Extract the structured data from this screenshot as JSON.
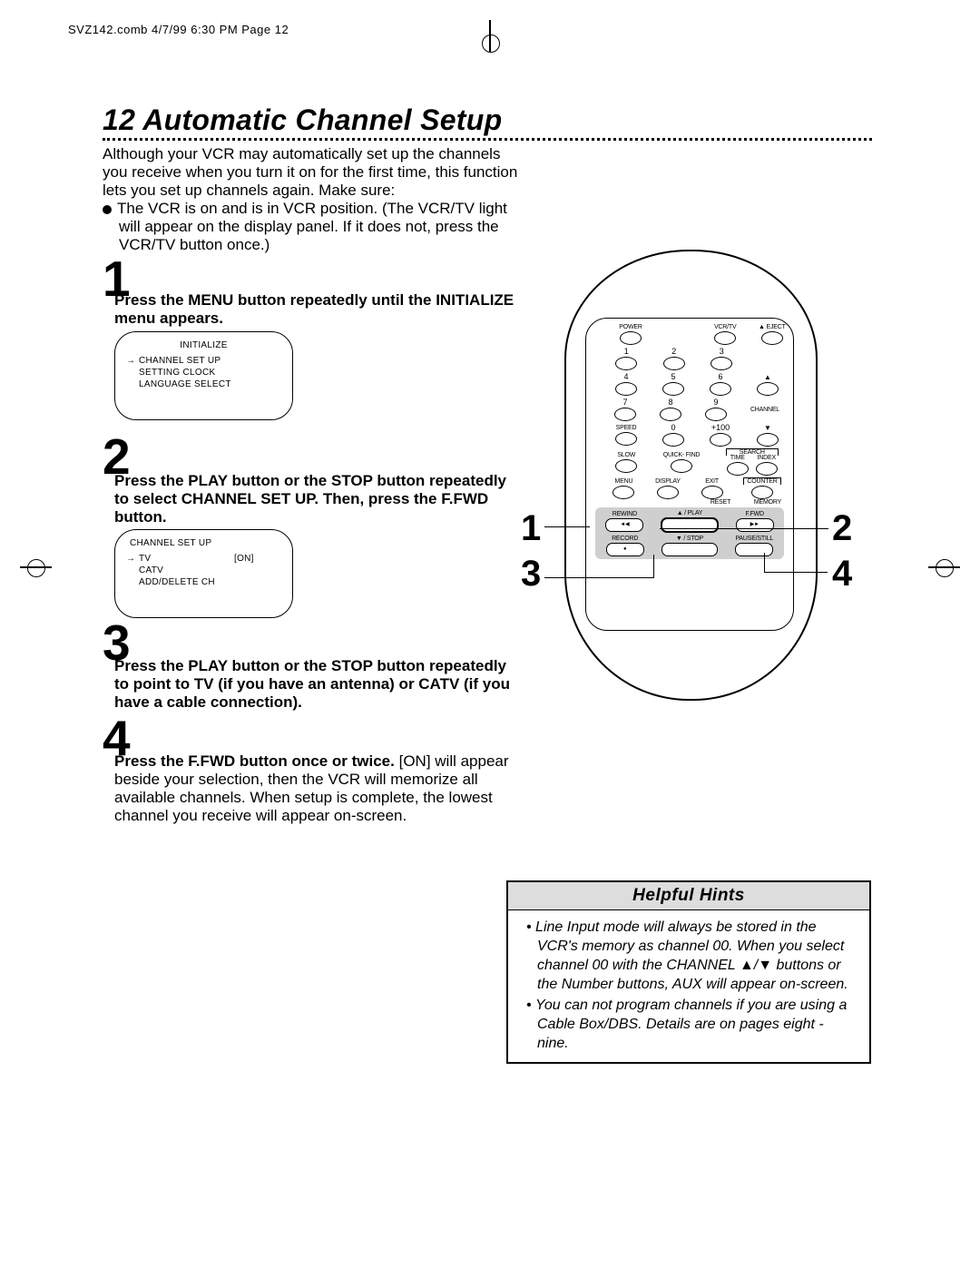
{
  "print_header": "SVZ142.comb  4/7/99  6:30 PM  Page 12",
  "title": "12  Automatic Channel Setup",
  "intro": {
    "p1": "Although your VCR may automatically set up the channels you receive when you turn it on for the first time, this function lets you set up channels again. Make sure:",
    "p2": "The VCR is on and is in VCR position. (The VCR/TV light will appear on the display panel. If it does not, press the VCR/TV button once.)"
  },
  "steps": {
    "n1": "1",
    "s1": "Press the MENU button repeatedly until the INITIALIZE menu appears.",
    "screen1": {
      "title": "INITIALIZE",
      "items": [
        "CHANNEL SET UP",
        "SETTING CLOCK",
        "LANGUAGE SELECT"
      ]
    },
    "n2": "2",
    "s2": "Press the PLAY button or the STOP button repeatedly to select CHANNEL SET UP. Then, press the F.FWD button.",
    "screen2": {
      "title": "CHANNEL SET UP",
      "items": [
        {
          "label": "TV",
          "val": "[ON]"
        },
        {
          "label": "CATV",
          "val": ""
        },
        {
          "label": "ADD/DELETE CH",
          "val": ""
        }
      ]
    },
    "n3": "3",
    "s3": "Press the PLAY button or the STOP button repeatedly to point to TV (if you have an antenna) or CATV (if you have a cable connection).",
    "n4": "4",
    "s4a": "Press the F.FWD button once or twice.",
    "s4b": " [ON] will appear beside your selection, then the VCR will memorize all available channels. When setup is complete, the lowest channel you receive will appear on-screen."
  },
  "remote": {
    "row1": [
      "POWER",
      "VCR/TV",
      "▲ EJECT"
    ],
    "nums_r1": [
      "1",
      "2",
      "3"
    ],
    "nums_r2": [
      "4",
      "5",
      "6"
    ],
    "nums_r3": [
      "7",
      "8",
      "9"
    ],
    "nums_r4_labels": [
      "SPEED",
      "0",
      "+100"
    ],
    "channel_label": "CHANNEL",
    "row_misc": [
      "SLOW",
      "QUICK-\nFIND",
      "SEARCH",
      ""
    ],
    "row_misc_sub": [
      "",
      "",
      "TIME",
      "INDEX"
    ],
    "row_menu": [
      "MENU",
      "DISPLAY",
      "EXIT",
      "COUNTER"
    ],
    "reset": "RESET",
    "memory": "MEMORY",
    "transport_r1": [
      "REWIND",
      "▲ / PLAY",
      "F.FWD"
    ],
    "transport_r2": [
      "RECORD",
      "▼ / STOP",
      "PAUSE/STILL"
    ],
    "tgly_rew": "◄◀",
    "tgly_ffwd": "▶►",
    "tgly_rec": "●"
  },
  "callouts": {
    "c1": "1",
    "c2": "2",
    "c3": "3",
    "c4": "4"
  },
  "hints": {
    "title": "Helpful Hints",
    "h1": "Line Input mode will always be stored in the VCR's memory as channel 00. When you select channel 00 with the CHANNEL ▲/▼ buttons or the Number buttons, AUX will appear on-screen.",
    "h2": "You can not program channels if you are using a Cable Box/DBS. Details are on pages eight - nine."
  }
}
